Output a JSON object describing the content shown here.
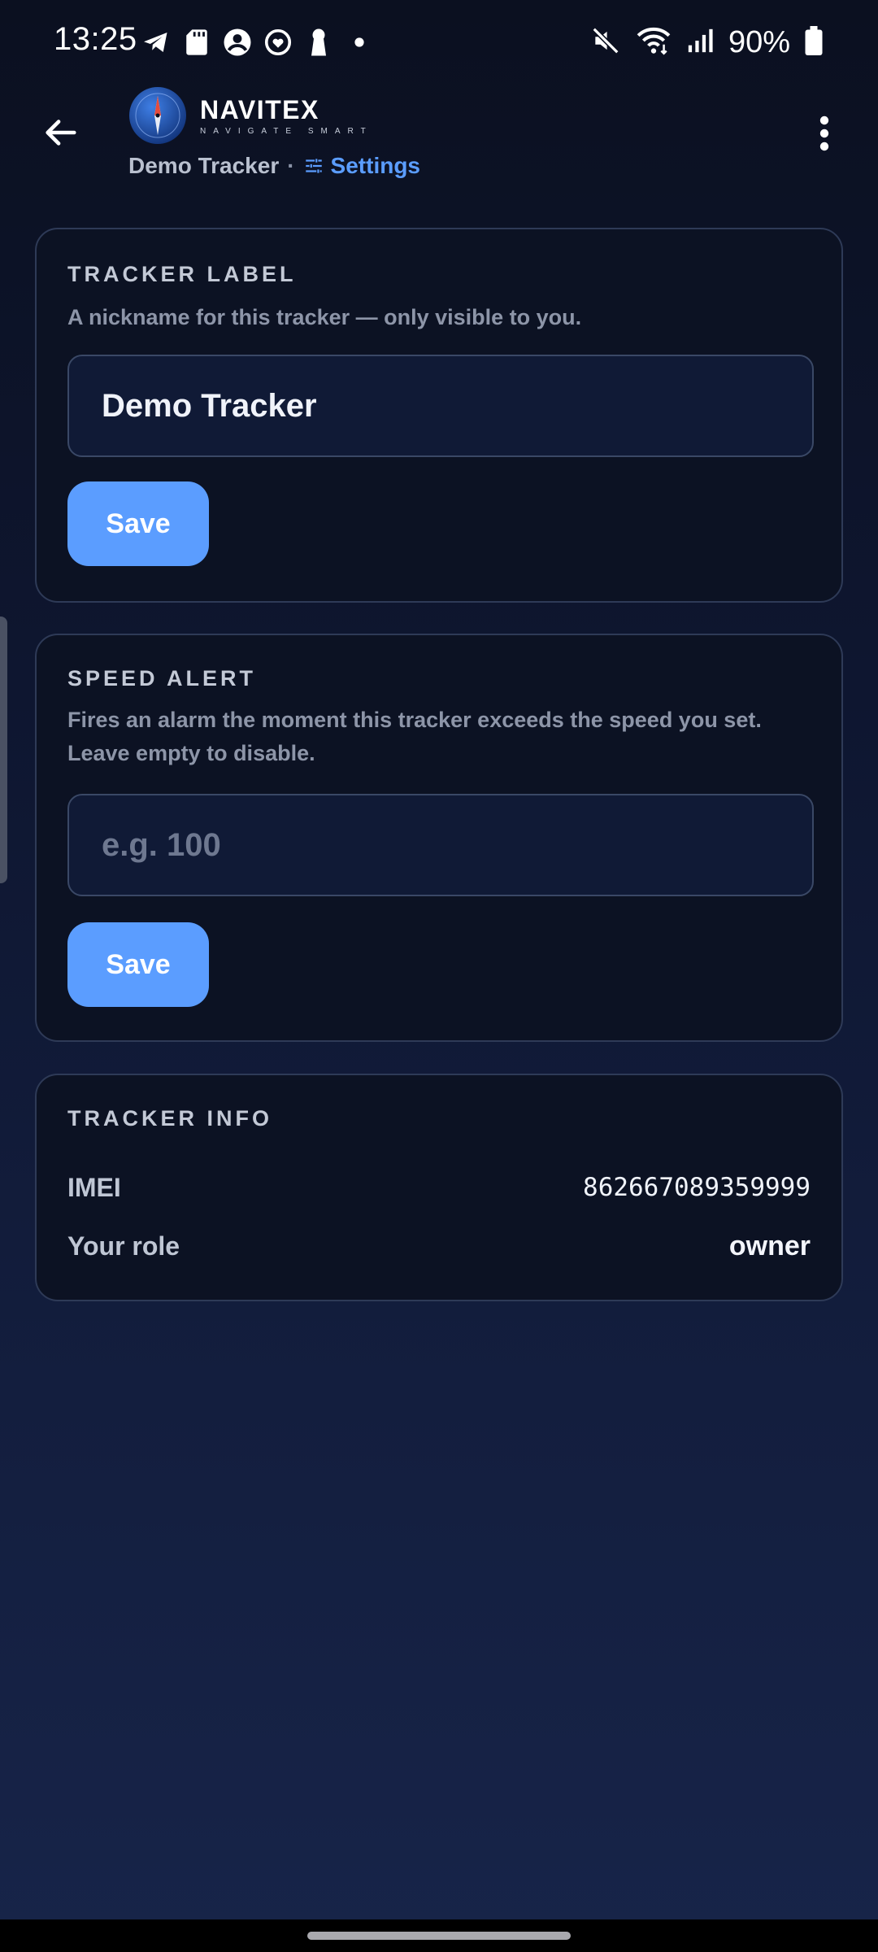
{
  "status_bar": {
    "time": "13:25",
    "battery": "90%",
    "left_icons": [
      "telegram-icon",
      "sd-card-icon",
      "account-circle-icon",
      "heart-sync-icon",
      "keyhole-icon",
      "dot-icon"
    ],
    "right_icons": [
      "mute-icon",
      "wifi-icon",
      "cell-signal-icon",
      "battery-icon"
    ]
  },
  "header": {
    "brand_name": "NAVITEX",
    "brand_tagline": "NAVIGATE SMART",
    "breadcrumb_tracker": "Demo Tracker",
    "breadcrumb_separator": "·",
    "breadcrumb_page": "Settings",
    "accent_color": "#5b9dff"
  },
  "tracker_label": {
    "title": "TRACKER LABEL",
    "description": "A nickname for this tracker — only visible to you.",
    "value": "Demo Tracker",
    "save_label": "Save"
  },
  "speed_alert": {
    "title": "SPEED ALERT",
    "description": "Fires an alarm the moment this tracker exceeds the speed you set. Leave empty to disable.",
    "placeholder": "e.g. 100",
    "value": "",
    "save_label": "Save"
  },
  "tracker_info": {
    "title": "TRACKER INFO",
    "imei_label": "IMEI",
    "imei_value": "862667089359999",
    "role_label": "Your role",
    "role_value": "owner"
  }
}
